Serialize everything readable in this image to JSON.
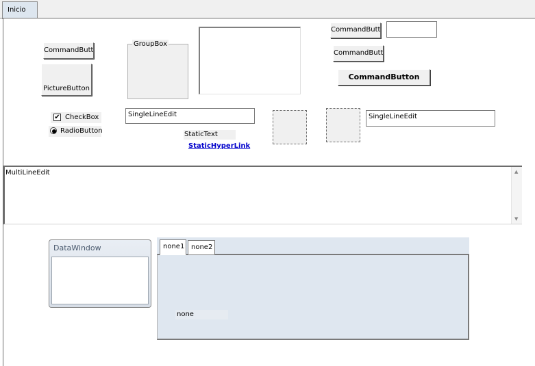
{
  "tabs": {
    "main_tab": "Inicio"
  },
  "controls": {
    "command_button_1": "CommandButton",
    "picture_button": "PictureButton",
    "groupbox": "GroupBox",
    "command_button_top": "CommandButton",
    "command_button_middle": "CommandButton",
    "command_button_bold": "CommandButton",
    "checkbox": "CheckBox",
    "radiobutton": "RadioButton",
    "single_line_edit_1": "SingleLineEdit",
    "static_text": "StaticText",
    "static_hyperlink": "StaticHyperLink",
    "single_line_edit_2": "SingleLineEdit",
    "multi_line_edit": "MultiLineEdit",
    "datawindow_title": "DataWindow"
  },
  "tab_control": {
    "tabs": [
      "none1",
      "none2"
    ],
    "content_label": "none"
  },
  "colors": {
    "hyperlink": "#0000cc",
    "tab_panel": "#dfe7f0"
  }
}
